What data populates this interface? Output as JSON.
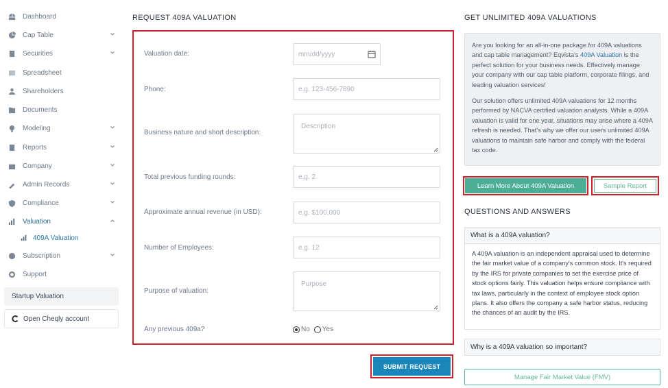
{
  "sidebar": {
    "items": [
      {
        "label": "Dashboard",
        "icon": "dashboard-icon"
      },
      {
        "label": "Cap Table",
        "icon": "cap-table-icon"
      },
      {
        "label": "Securities",
        "icon": "securities-icon"
      },
      {
        "label": "Spreadsheet",
        "icon": "spreadsheet-icon"
      },
      {
        "label": "Shareholders",
        "icon": "shareholders-icon"
      },
      {
        "label": "Documents",
        "icon": "documents-icon"
      },
      {
        "label": "Modeling",
        "icon": "modeling-icon"
      },
      {
        "label": "Reports",
        "icon": "reports-icon"
      },
      {
        "label": "Company",
        "icon": "company-icon"
      },
      {
        "label": "Admin Records",
        "icon": "admin-records-icon"
      },
      {
        "label": "Compliance",
        "icon": "compliance-icon"
      },
      {
        "label": "Valuation",
        "icon": "valuation-icon"
      },
      {
        "label": "Subscription",
        "icon": "subscription-icon"
      },
      {
        "label": "Support",
        "icon": "support-icon"
      }
    ],
    "sub_item": {
      "label": "409A Valuation",
      "icon": "valuation-icon"
    },
    "startup_button": "Startup Valuation",
    "cheqly_button": "Open Cheqly account"
  },
  "form": {
    "title": "REQUEST 409A VALUATION",
    "fields": [
      {
        "label": "Valuation date:",
        "placeholder": "mm/dd/yyyy"
      },
      {
        "label": "Phone:",
        "placeholder": "e.g. 123-456-7890"
      },
      {
        "label": "Business nature and short description:",
        "placeholder": "Description"
      },
      {
        "label": "Total previous funding rounds:",
        "placeholder": "e.g. 2"
      },
      {
        "label": "Approximate annual revenue (in USD):",
        "placeholder": "e.g. $100,000"
      },
      {
        "label": "Number of Employees:",
        "placeholder": "e.g. 12"
      },
      {
        "label": "Purpose of valuation:",
        "placeholder": "Purpose"
      },
      {
        "label": "Any previous 409a?"
      }
    ],
    "radio_no": "No",
    "radio_yes": "Yes",
    "radio_selected": "No",
    "submit_label": "SUBMIT REQUEST"
  },
  "promo": {
    "title": "GET UNLIMITED 409A VALUATIONS",
    "para1_a": "Are you looking for an all-in-one package for 409A valuations and cap table management? Eqvista's ",
    "para1_link": "409A Valuation",
    "para1_b": " is the perfect solution for your business needs. Effectively manage your company with our cap table platform, corporate filings, and leading valuation services!",
    "para2": "Our solution offers unlimited 409A valuations for 12 months performed by NACVA certified valuation analysts. While a 409A valuation is valid for one year, situations may arise where a 409A refresh is needed. That's why we offer our users unlimited 409A valuations to maintain safe harbor and comply with the federal tax code.",
    "learn_more_label": "Learn More About 409A Valuation",
    "sample_report_label": "Sample Report"
  },
  "qa": {
    "title": "QUESTIONS AND ANSWERS",
    "q1": "What is a 409A valuation?",
    "a1": "A 409A valuation is an independent appraisal used to determine the fair market value of a company's common stock. It's required by the IRS for private companies to set the exercise price of stock options fairly. This valuation helps ensure compliance with tax laws, particularly in the context of employee stock option plans. It also offers the company a safe harbor status, reducing the chances of an audit by the IRS.",
    "q2": "Why is a 409A valuation so important?",
    "fmv_label": "Manage Fair Market Value (FMV)"
  },
  "colors": {
    "accent": "#1a86ba",
    "green": "#4caf95",
    "highlight": "#d0202b"
  }
}
